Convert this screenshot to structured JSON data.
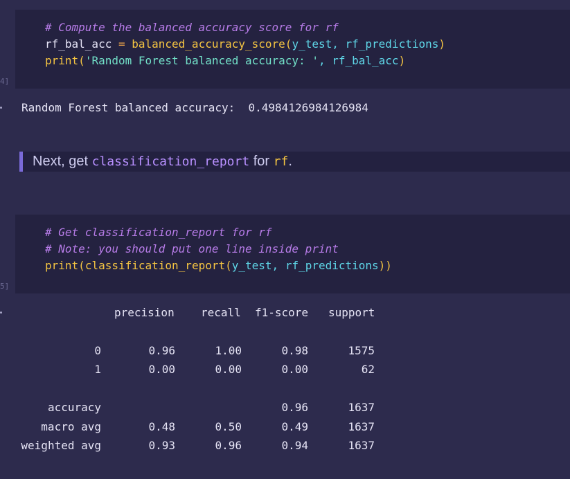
{
  "cell1": {
    "exec_count": "4]",
    "comment": "# Compute the balanced accuracy score for rf",
    "line2": {
      "var": "rf_bal_acc",
      "op": " = ",
      "func": "balanced_accuracy_score",
      "open": "(",
      "args": "y_test, rf_predictions",
      "close": ")"
    },
    "line3": {
      "func": "print",
      "open": "(",
      "str": "'Random Forest balanced accuracy: '",
      "rest": ", rf_bal_acc",
      "close": ")"
    },
    "output": "Random Forest balanced accuracy:  0.4984126984126984"
  },
  "markdown": {
    "t1": "Next, get ",
    "code1": "classification_report",
    "t2": " for ",
    "code2": "rf",
    "t3": "."
  },
  "cell2": {
    "exec_count": "5]",
    "comment1": "# Get classification_report for rf",
    "comment2": "# Note: you should put one line inside print",
    "line3": {
      "func": "print",
      "open": "(",
      "func2": "classification_report",
      "open2": "(",
      "args": "y_test, rf_predictions",
      "close": "))"
    }
  },
  "report": {
    "header": [
      "precision",
      "recall",
      "f1-score",
      "support"
    ],
    "rows": [
      {
        "label": "0",
        "precision": "0.96",
        "recall": "1.00",
        "f1": "0.98",
        "support": "1575"
      },
      {
        "label": "1",
        "precision": "0.00",
        "recall": "0.00",
        "f1": "0.00",
        "support": "62"
      },
      {
        "label": "accuracy",
        "precision": "",
        "recall": "",
        "f1": "0.96",
        "support": "1637"
      },
      {
        "label": "macro avg",
        "precision": "0.48",
        "recall": "0.50",
        "f1": "0.49",
        "support": "1637"
      },
      {
        "label": "weighted avg",
        "precision": "0.93",
        "recall": "0.96",
        "f1": "0.94",
        "support": "1637"
      }
    ]
  },
  "colors": {
    "background": "#2d2b4d",
    "cell": "#242240",
    "comment": "#b77ce8",
    "function": "#f5c542",
    "param": "#5fd7e8"
  }
}
